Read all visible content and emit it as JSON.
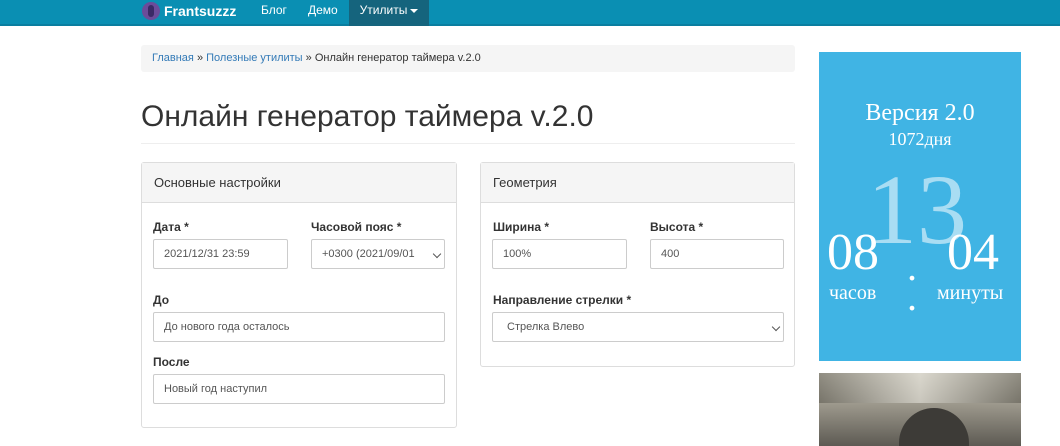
{
  "navbar": {
    "brand": "Frantsuzzz",
    "items": [
      "Блог",
      "Демо",
      "Утилиты"
    ]
  },
  "breadcrumb": {
    "home": "Главная",
    "sep1": "»",
    "utils": "Полезные утилиты",
    "sep2": "»",
    "current": "Онлайн генератор таймера v.2.0"
  },
  "page_title": "Онлайн генератор таймера v.2.0",
  "main_settings": {
    "heading": "Основные настройки",
    "date_label": "Дата *",
    "date_value": "2021/12/31 23:59",
    "tz_label": "Часовой пояс *",
    "tz_value": "+0300 (2021/09/01",
    "before_label": "До",
    "before_value": "До нового года осталось",
    "after_label": "После",
    "after_value": "Новый год наступил"
  },
  "geometry": {
    "heading": "Геометрия",
    "width_label": "Ширина *",
    "width_value": "100%",
    "height_label": "Высота *",
    "height_value": "400",
    "arrow_label": "Направление стрелки *",
    "arrow_value": "Стрелка Влево"
  },
  "timer": {
    "version": "Версия 2.0",
    "days": "1072дня",
    "big": "13",
    "hours": "08",
    "minutes": "04",
    "hours_label": "часов",
    "minutes_label": "минуты",
    "bg_color": "#40b4e4"
  },
  "colors": {
    "navbar": "#0a8fb3",
    "link": "#337ab7"
  }
}
